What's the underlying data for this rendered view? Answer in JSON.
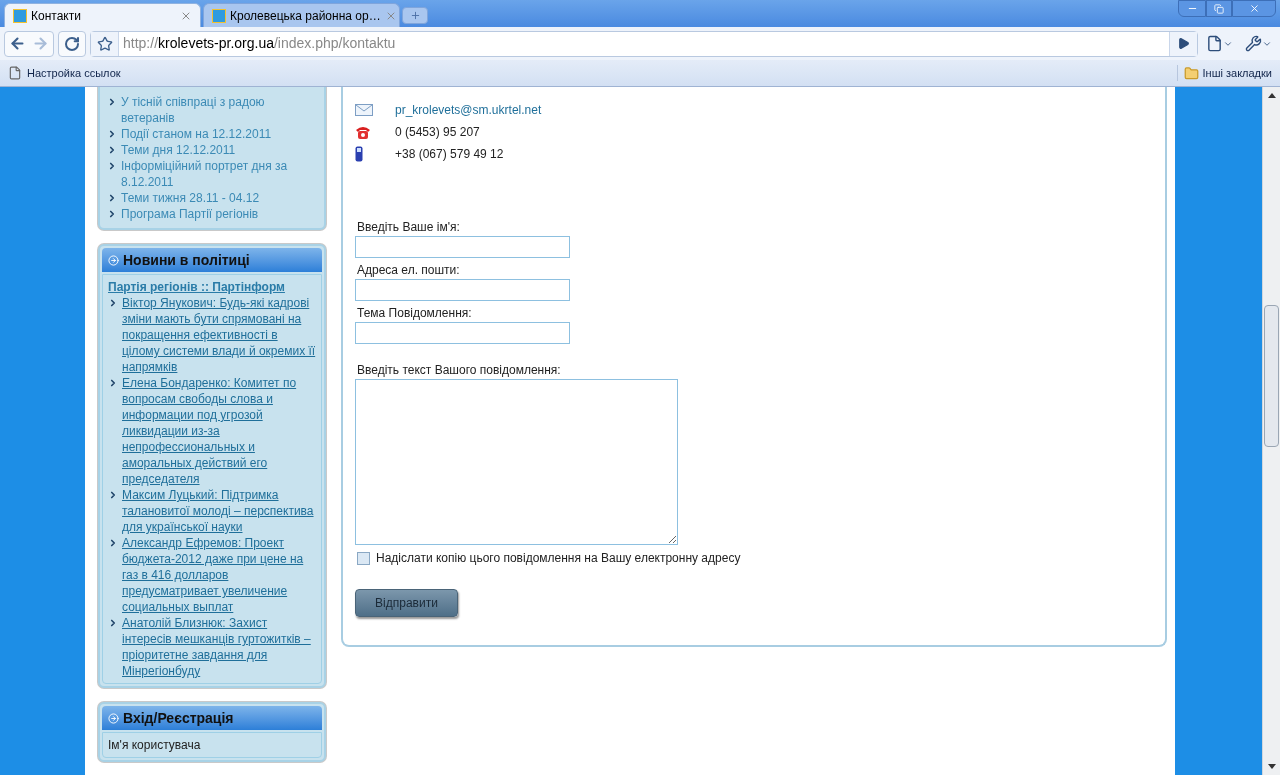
{
  "browser": {
    "tabs": [
      {
        "title": "Контакти",
        "selected": true
      },
      {
        "title": "Кролевецька районна ор…",
        "selected": false
      }
    ],
    "url": {
      "scheme": "http://",
      "host": "krolevets-pr.org.ua",
      "path": "/index.php/kontaktu"
    },
    "bookmarks": [
      "Настройка ссылок"
    ],
    "other_bookmarks": "Інші закладки"
  },
  "sidebar": {
    "top_list": [
      "У тісній співпраці з радою ветеранів",
      "Події станом на 12.12.2011",
      "Теми дня 12.12.2011",
      "Інформіційний портрет дня за 8.12.2011",
      "Теми тижня 28.11 - 04.12",
      "Програма Партії регіонів"
    ],
    "politics": {
      "title": "Новини в політиці",
      "feed_title": "Партія регіонів :: Партінформ",
      "items": [
        "Віктор Янукович: Будь-які кадрові зміни мають бути спрямовані на покращення ефективності в цілому системи влади й окремих її напрямків",
        "Елена Бондаренко: Комитет по вопросам свободы слова и информации под угрозой ликвидации из-за непрофессиональных и аморальных действий его председателя",
        "Максим Луцький: Підтримка талановитої молоді – перспектива для української науки",
        "Александр Ефремов: Проект бюджета-2012 даже при цене на газ в 416 долларов предусматривает увеличение социальных выплат",
        "Анатолій Близнюк: Захист інтересів мешканців гуртожитків – пріоритетне завдання для Мінрегіонбуду"
      ]
    },
    "login": {
      "title": "Вхід/Реєстрація",
      "label": "Ім'я користувача"
    }
  },
  "contact": {
    "items": [
      {
        "kind": "email",
        "text": "pr_krolevets@sm.ukrtel.net"
      },
      {
        "kind": "phone",
        "text": "0 (5453) 95 207"
      },
      {
        "kind": "mobile",
        "text": "+38 (067) 579 49 12"
      }
    ],
    "fields": [
      {
        "kind": "input",
        "label": "Введіть Ваше ім'я:"
      },
      {
        "kind": "input",
        "label": "Адреса ел. пошти:"
      },
      {
        "kind": "input",
        "label": "Тема Повідомлення:"
      },
      {
        "kind": "textarea",
        "label": "Введіть текст Вашого повідомлення:"
      }
    ],
    "copy_checkbox": {
      "label": "Надіслати копію цього повідомлення на Вашу електронну адресу",
      "checked": false
    },
    "submit": "Відправити"
  }
}
